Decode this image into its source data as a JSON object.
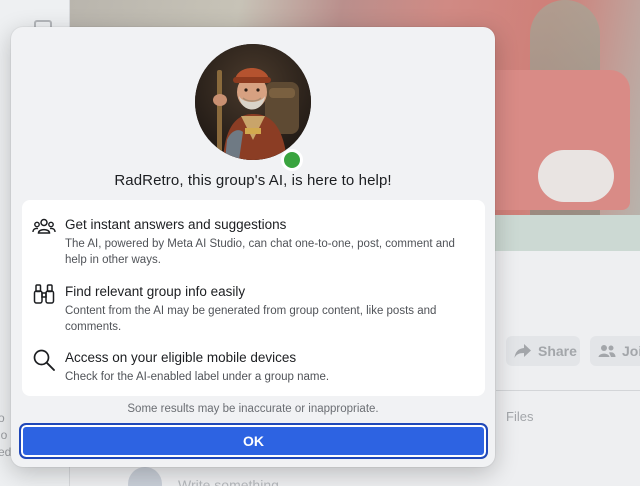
{
  "background": {
    "sidebar_text": "o\nlo\ned.",
    "share_label": "Share",
    "join_label": "Joi",
    "files_tab": "Files",
    "composer_placeholder": "Write something..."
  },
  "modal": {
    "title": "RadRetro, this group's AI, is here to help!",
    "avatar": {
      "icon": "ai-character-avatar",
      "status": "online",
      "status_color": "#3aa43f"
    },
    "features": [
      {
        "icon": "people-group-icon",
        "heading": "Get instant answers and suggestions",
        "description": "The AI, powered by Meta AI Studio, can chat one-to-one, post, comment and help in other ways."
      },
      {
        "icon": "binoculars-icon",
        "heading": "Find relevant group info easily",
        "description": "Content from the AI may be generated from group content, like posts and comments."
      },
      {
        "icon": "search-icon",
        "heading": "Access on your eligible mobile devices",
        "description": "Check for the AI-enabled label under a group name."
      }
    ],
    "disclaimer": "Some results may be inaccurate or inappropriate.",
    "ok_label": "OK",
    "accent_color": "#2d63e2"
  }
}
